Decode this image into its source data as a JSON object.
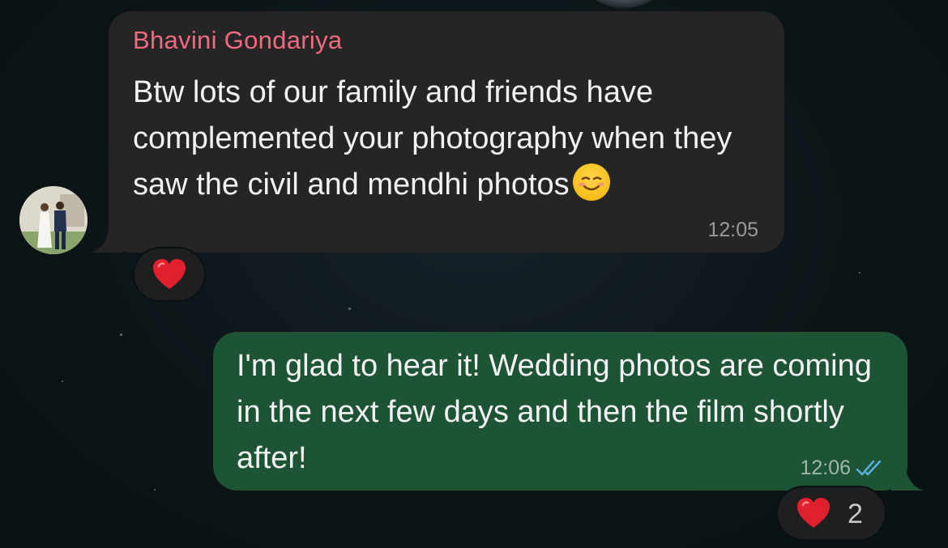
{
  "incoming_message": {
    "sender": "Bhavini Gondariya",
    "text": "Btw lots of our family and friends have complemented your photography when they saw the civil and mendhi photos",
    "emoji": "smiling-face-emoji",
    "time": "12:05",
    "reaction": {
      "icon": "red-heart-icon"
    }
  },
  "outgoing_message": {
    "text": "I'm glad to hear it! Wedding photos are coming in the next few days and then the film shortly after!",
    "time": "12:06",
    "status_icon": "double-check-read-icon",
    "reaction": {
      "icon": "red-heart-icon",
      "count": "2"
    }
  },
  "colors": {
    "sender_name": "#f06a80",
    "incoming_bubble": "#252525",
    "outgoing_bubble": "#1d5436",
    "read_checks": "#5ab4e8",
    "heart": "#e0202c"
  }
}
